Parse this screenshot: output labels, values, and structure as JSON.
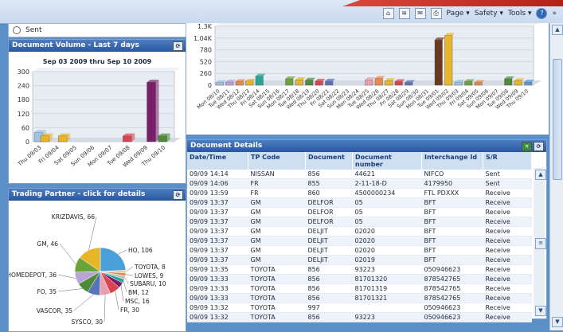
{
  "toolbar": {
    "page": "Page",
    "safety": "Safety",
    "tools": "Tools",
    "chevron": "»"
  },
  "radio": {
    "label": "Sent"
  },
  "volume": {
    "title": "Document Volume - Last 7 days",
    "subtitle": "Sep 03 2009 thru Sep 10 2009"
  },
  "volume_chart": {
    "type": "bar",
    "categories": [
      "Thu 09/03",
      "Fri 09/04",
      "Sat 09/05",
      "Sun 09/06",
      "Mon 09/07",
      "Tue 09/08",
      "Wed 09/09",
      "Thu 09/10"
    ],
    "series": [
      {
        "color": "#9dc3e6",
        "values": [
          40,
          0,
          0,
          0,
          0,
          0,
          0,
          0
        ]
      },
      {
        "color": "#e8b52a",
        "values": [
          25,
          25,
          0,
          0,
          0,
          0,
          0,
          0
        ]
      },
      {
        "color": "#d9444e",
        "values": [
          0,
          0,
          0,
          0,
          0,
          25,
          0,
          0
        ]
      },
      {
        "color": "#7a1e6a",
        "values": [
          0,
          0,
          0,
          0,
          0,
          0,
          255,
          0
        ]
      },
      {
        "color": "#4e8a3a",
        "values": [
          0,
          0,
          0,
          0,
          0,
          0,
          0,
          25
        ]
      }
    ],
    "yticks": [
      "300",
      "240",
      "180",
      "120",
      "60",
      "0"
    ],
    "ylim": [
      0,
      300
    ]
  },
  "right_chart": {
    "type": "bar",
    "yticks": [
      "1.3K",
      "1.04K",
      "780",
      "520",
      "260",
      "0"
    ],
    "ylim": [
      0,
      1300
    ],
    "categories": [
      "Mon 08/10",
      "Tue 08/11",
      "Wed 08/12",
      "Thu 08/13",
      "Fri 08/14",
      "Sat 08/15",
      "Sun 08/16",
      "Mon 08/17",
      "Tue 08/18",
      "Wed 08/19",
      "Thu 08/20",
      "Fri 08/21",
      "Sat 08/22",
      "Sun 08/23",
      "Mon 08/24",
      "Tue 08/25",
      "Wed 08/26",
      "Thu 08/27",
      "Fri 08/28",
      "Sat 08/29",
      "Sun 08/30",
      "Mon 08/31",
      "Tue 09/01",
      "Wed 09/02",
      "Thu 09/03",
      "Fri 09/04",
      "Sat 09/05",
      "Sun 09/06",
      "Mon 09/07",
      "Tue 09/08",
      "Wed 09/09",
      "Thu 09/10"
    ],
    "bars": [
      {
        "c": 0,
        "v": 60,
        "color": "#9dc3e6"
      },
      {
        "c": 1,
        "v": 70,
        "color": "#b9a3d8"
      },
      {
        "c": 2,
        "v": 80,
        "color": "#e8884a"
      },
      {
        "c": 3,
        "v": 90,
        "color": "#e8b52a"
      },
      {
        "c": 4,
        "v": 200,
        "color": "#2aa59a"
      },
      {
        "c": 7,
        "v": 140,
        "color": "#6aa33a"
      },
      {
        "c": 8,
        "v": 120,
        "color": "#e8b52a"
      },
      {
        "c": 9,
        "v": 110,
        "color": "#4e8a3a"
      },
      {
        "c": 10,
        "v": 90,
        "color": "#d9444e"
      },
      {
        "c": 11,
        "v": 90,
        "color": "#5a72b8"
      },
      {
        "c": 15,
        "v": 120,
        "color": "#e8a0b0"
      },
      {
        "c": 16,
        "v": 150,
        "color": "#e8884a"
      },
      {
        "c": 17,
        "v": 100,
        "color": "#e8b52a"
      },
      {
        "c": 18,
        "v": 80,
        "color": "#d9444e"
      },
      {
        "c": 19,
        "v": 60,
        "color": "#5a72b8"
      },
      {
        "c": 22,
        "v": 1000,
        "color": "#6a3a1e"
      },
      {
        "c": 23,
        "v": 1100,
        "color": "#e8b52a"
      },
      {
        "c": 24,
        "v": 70,
        "color": "#9dc3e6"
      },
      {
        "c": 25,
        "v": 80,
        "color": "#6aa33a"
      },
      {
        "c": 26,
        "v": 60,
        "color": "#e8884a"
      },
      {
        "c": 29,
        "v": 140,
        "color": "#4e8a3a"
      },
      {
        "c": 30,
        "v": 100,
        "color": "#e8b52a"
      },
      {
        "c": 31,
        "v": 70,
        "color": "#5a9ad8"
      }
    ]
  },
  "partner": {
    "title": "Trading Partner - click for details",
    "slices": [
      {
        "label": "HO, 106",
        "value": 106,
        "color": "#4aa0d8"
      },
      {
        "label": "TOYOTA, 8",
        "value": 8,
        "color": "#f0c8a0"
      },
      {
        "label": "LOWES, 9",
        "value": 9,
        "color": "#e8884a"
      },
      {
        "label": "SUBARU, 10",
        "value": 10,
        "color": "#c0c0c0"
      },
      {
        "label": "BM, 12",
        "value": 12,
        "color": "#2aa59a"
      },
      {
        "label": "MSC, 16",
        "value": 16,
        "color": "#7a1e6a"
      },
      {
        "label": "FR, 30",
        "value": 30,
        "color": "#d9444e"
      },
      {
        "label": "SYSCO, 30",
        "value": 30,
        "color": "#e8a0b0"
      },
      {
        "label": "VASCOR, 35",
        "value": 35,
        "color": "#5a72b8"
      },
      {
        "label": "FO, 35",
        "value": 35,
        "color": "#4e8a3a"
      },
      {
        "label": "HOMEDEPOT, 36",
        "value": 36,
        "color": "#b9a3d8"
      },
      {
        "label": "GM, 46",
        "value": 46,
        "color": "#6aa33a"
      },
      {
        "label": "KRIZDAVIS, 66",
        "value": 66,
        "color": "#e8b52a"
      }
    ]
  },
  "details": {
    "title": "Document Details",
    "columns": [
      "Date/Time",
      "TP Code",
      "Document",
      "Document number",
      "Interchange Id",
      "S/R"
    ],
    "rows": [
      [
        "09/09 14:14",
        "NISSAN",
        "856",
        "44621",
        "NIFCO",
        "Sent"
      ],
      [
        "09/09 14:06",
        "FR",
        "855",
        "2-11-18-D",
        "4179950",
        "Sent"
      ],
      [
        "09/09 13:59",
        "FR",
        "860",
        "4500000234",
        "FTL PDXXX",
        "Receive"
      ],
      [
        "09/09 13:37",
        "GM",
        "DELFOR",
        "05",
        "BFT",
        "Receive"
      ],
      [
        "09/09 13:37",
        "GM",
        "DELFOR",
        "05",
        "BFT",
        "Receive"
      ],
      [
        "09/09 13:37",
        "GM",
        "DELFOR",
        "05",
        "BFT",
        "Receive"
      ],
      [
        "09/09 13:37",
        "GM",
        "DELJIT",
        "02020",
        "BFT",
        "Receive"
      ],
      [
        "09/09 13:37",
        "GM",
        "DELJIT",
        "02020",
        "BFT",
        "Receive"
      ],
      [
        "09/09 13:37",
        "GM",
        "DELJIT",
        "02020",
        "BFT",
        "Receive"
      ],
      [
        "09/09 13:37",
        "GM",
        "DELJIT",
        "02019",
        "BFT",
        "Receive"
      ],
      [
        "09/09 13:35",
        "TOYOTA",
        "856",
        "93223",
        "050946623",
        "Receive"
      ],
      [
        "09/09 13:33",
        "TOYOTA",
        "856",
        "81701320",
        "878542765",
        "Receive"
      ],
      [
        "09/09 13:33",
        "TOYOTA",
        "856",
        "81701319",
        "878542765",
        "Receive"
      ],
      [
        "09/09 13:33",
        "TOYOTA",
        "856",
        "81701321",
        "878542765",
        "Receive"
      ],
      [
        "09/09 13:32",
        "TOYOTA",
        "997",
        "",
        "050946623",
        "Receive"
      ],
      [
        "09/09 13:32",
        "TOYOTA",
        "856",
        "93223",
        "050946623",
        "Receive"
      ]
    ]
  }
}
